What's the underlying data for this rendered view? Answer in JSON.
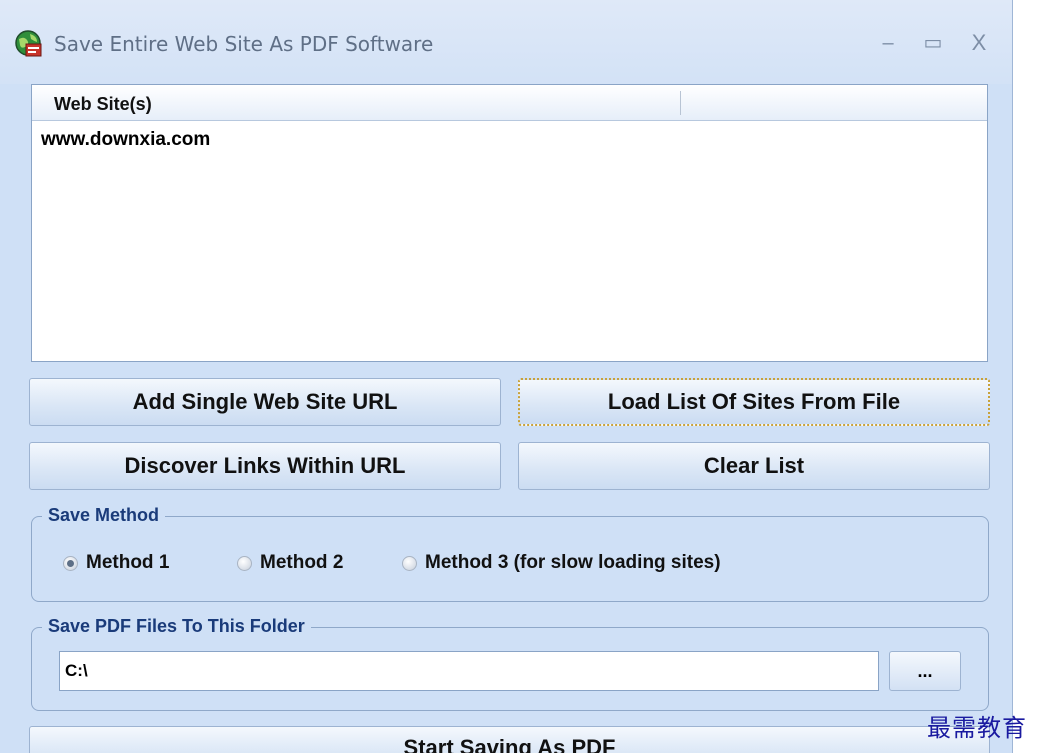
{
  "window": {
    "title": "Save Entire Web Site As PDF Software",
    "controls": {
      "minimize": "–",
      "maximize": "▭",
      "close": "X"
    }
  },
  "site_list": {
    "column_header": "Web Site(s)",
    "rows": [
      "www.downxia.com"
    ]
  },
  "buttons": {
    "add_single": "Add Single Web Site URL",
    "load_list": "Load List Of Sites From File",
    "discover_links": "Discover Links Within URL",
    "clear_list": "Clear List",
    "browse": "...",
    "start": "Start Saving As PDF"
  },
  "save_method": {
    "legend": "Save Method",
    "options": [
      {
        "label": "Method 1",
        "checked": true
      },
      {
        "label": "Method 2",
        "checked": false
      },
      {
        "label": "Method 3 (for slow loading sites)",
        "checked": false
      }
    ]
  },
  "output_folder": {
    "legend": "Save PDF Files To This Folder",
    "value": "C:\\"
  },
  "watermark": "最需教育",
  "colors": {
    "window_bg": "#cfe0f6",
    "legend_text": "#1a3b7a",
    "focus_border": "#c9a23a"
  }
}
